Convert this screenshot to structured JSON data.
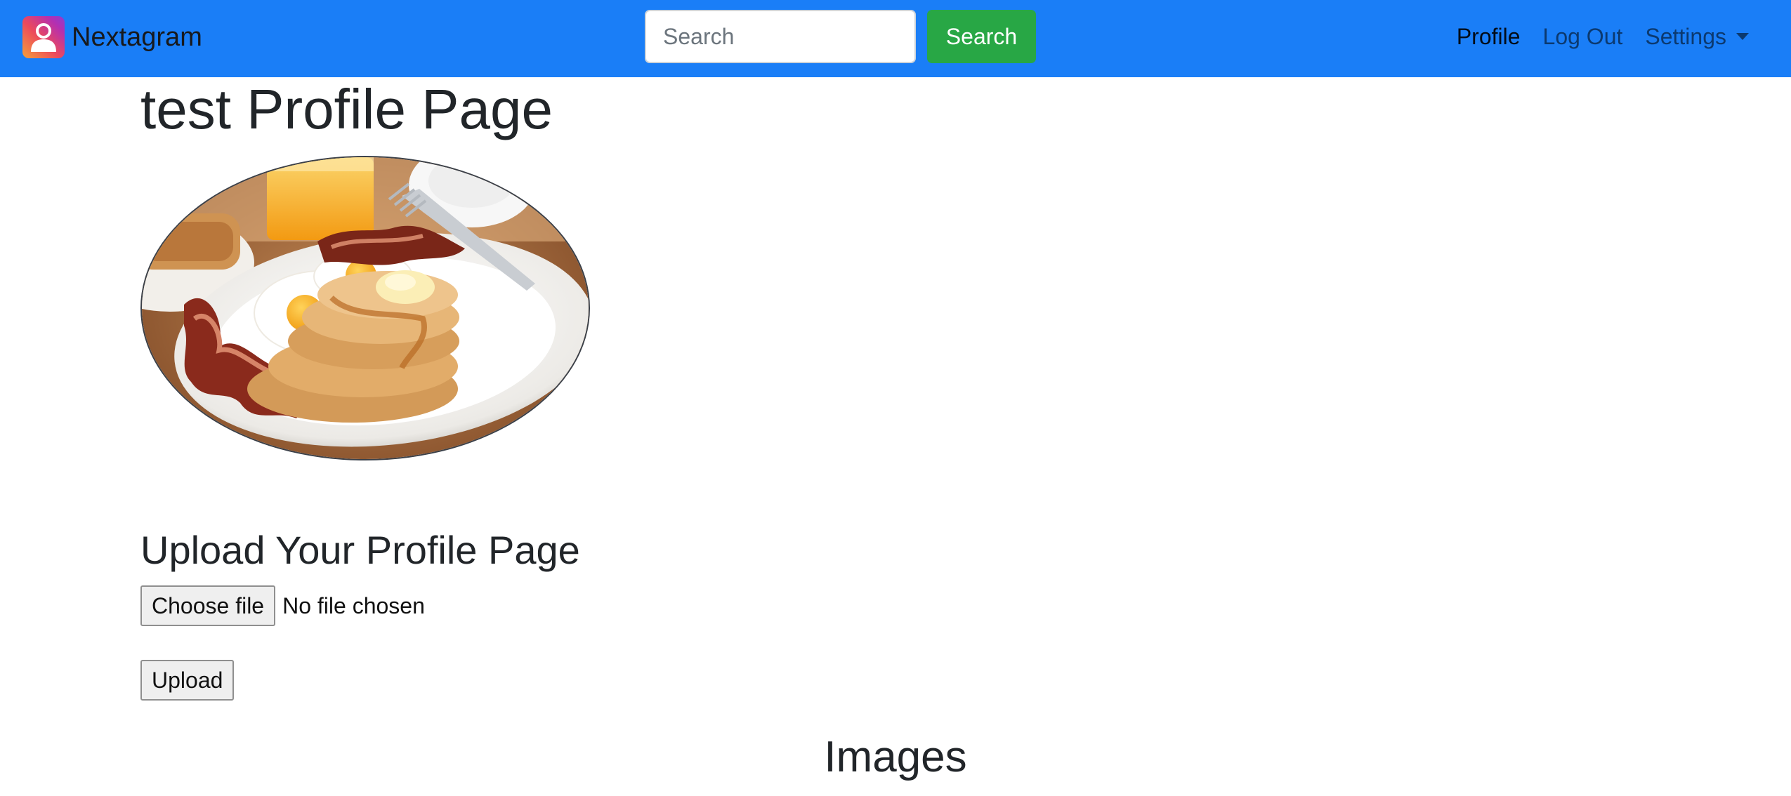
{
  "navbar": {
    "brand_name": "Nextagram",
    "brand_logo_icon": "user-avatar-icon",
    "search_placeholder": "Search",
    "search_button_label": "Search",
    "links": {
      "profile": "Profile",
      "logout": "Log Out",
      "settings": "Settings"
    }
  },
  "main": {
    "page_title": "test Profile Page",
    "profile_image_subject": "breakfast plate with pancakes, eggs and bacon",
    "upload_heading": "Upload Your Profile Page",
    "choose_file_label": "Choose file",
    "file_status": "No file chosen",
    "upload_button_label": "Upload",
    "images_heading": "Images"
  },
  "colors": {
    "navbar_bg": "#1a7ef7",
    "search_button_bg": "#28a745"
  }
}
